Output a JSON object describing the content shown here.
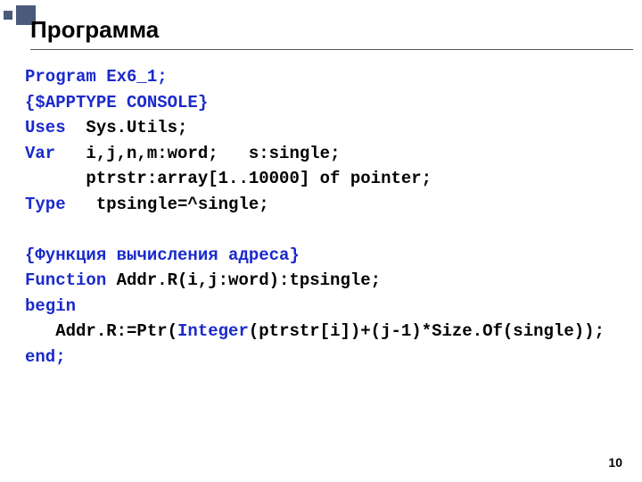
{
  "slide": {
    "title": "Программа",
    "page_number": "10"
  },
  "code": {
    "l1": "Program Ex6_1;",
    "l2": "{$APPTYPE CONSOLE}",
    "l3a": "Uses",
    "l3b": "  Sys.Utils;",
    "l4a": "Var",
    "l4b": "   i,j,n,m:word;   s:single;",
    "l5": "      ptrstr:array[1..10000] of pointer;",
    "l6a": "Type",
    "l6b": "   tpsingle=^single;",
    "l7": "{Функция вычисления адреса}",
    "l8a": "Function",
    "l8b": " Addr.R(i,j:word):tpsingle;",
    "l9": "begin",
    "l10a": "   Addr.R:=Ptr(",
    "l10b": "Integer",
    "l10c": "(ptrstr[i])+(j-1)*Size.Of(single));",
    "l11": "end;"
  }
}
